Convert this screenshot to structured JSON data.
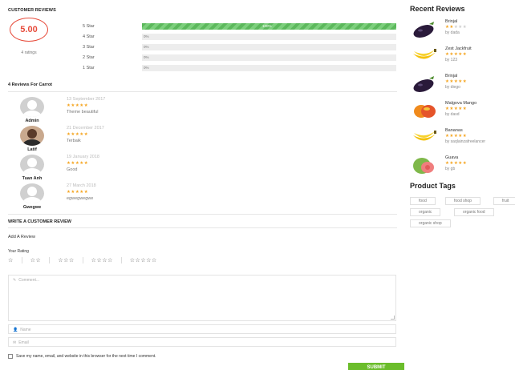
{
  "rating_summary": {
    "title": "CUSTOMER REVIEWS",
    "average": "5.00",
    "count_label": "4 ratings",
    "rows": [
      {
        "label": "5 Star",
        "percent_text": "100%",
        "fill": 1.0
      },
      {
        "label": "4 Star",
        "percent_text": "0%",
        "fill": 0
      },
      {
        "label": "3 Star",
        "percent_text": "0%",
        "fill": 0
      },
      {
        "label": "2 Star",
        "percent_text": "0%",
        "fill": 0
      },
      {
        "label": "1 Star",
        "percent_text": "0%",
        "fill": 0
      }
    ]
  },
  "reviews": {
    "title": "4 Reviews For Carrot",
    "items": [
      {
        "author": "Admin",
        "date": "13 September 2017",
        "stars": "★★★★★",
        "text": "Theme beautiful",
        "avatar": "default-avatar-icon"
      },
      {
        "author": "Latif",
        "date": "21 December 2017",
        "stars": "★★★★★",
        "text": "Terbaik",
        "avatar": "photo"
      },
      {
        "author": "Tuan Anh",
        "date": "19 January 2018",
        "stars": "★★★★★",
        "text": "Good",
        "avatar": "default-avatar-icon"
      },
      {
        "author": "Gwegwe",
        "date": "27 March 2018",
        "stars": "★★★★★",
        "text": "egwegwegwe",
        "avatar": "default-avatar-icon"
      }
    ]
  },
  "form": {
    "title": "WRITE A CUSTOMER REVIEW",
    "add_review": "Add A Review",
    "your_rating": "Your Rating",
    "star_options": [
      "☆",
      "☆☆",
      "☆☆☆",
      "☆☆☆☆",
      "☆☆☆☆☆"
    ],
    "comment_placeholder": "Comment...",
    "name_placeholder": "Name",
    "email_placeholder": "Email",
    "save_label": "Save my name, email, and website in this browser for the next time I comment.",
    "submit_label": "SUBMIT"
  },
  "recent_reviews": {
    "title": "Recent Reviews",
    "items": [
      {
        "name": "Brinjal",
        "stars_on": "★★",
        "stars_off": "★★★",
        "by": "by dada",
        "thumb": "eggplant"
      },
      {
        "name": "Zest Jackfruit",
        "stars_on": "★★★★★",
        "stars_off": "",
        "by": "by 123",
        "thumb": "banana"
      },
      {
        "name": "Brinjal",
        "stars_on": "★★★★★",
        "stars_off": "",
        "by": "by diego",
        "thumb": "eggplant"
      },
      {
        "name": "Malgova Mango",
        "stars_on": "★★★★★",
        "stars_off": "",
        "by": "by dasd",
        "thumb": "mango"
      },
      {
        "name": "Bananas",
        "stars_on": "★★★★★",
        "stars_off": "",
        "by": "by saqlainzafreelancer",
        "thumb": "banana"
      },
      {
        "name": "Guava",
        "stars_on": "★★★★★",
        "stars_off": "",
        "by": "by gb",
        "thumb": "guava"
      }
    ]
  },
  "product_tags": {
    "title": "Product Tags",
    "tags": [
      "food",
      "food shop",
      "fruit",
      "organic",
      "organic food",
      "organic shop"
    ]
  },
  "colors": {
    "accent_green": "#6bbd2b",
    "rating_red": "#e74c3c",
    "star_gold": "#f5a623"
  }
}
